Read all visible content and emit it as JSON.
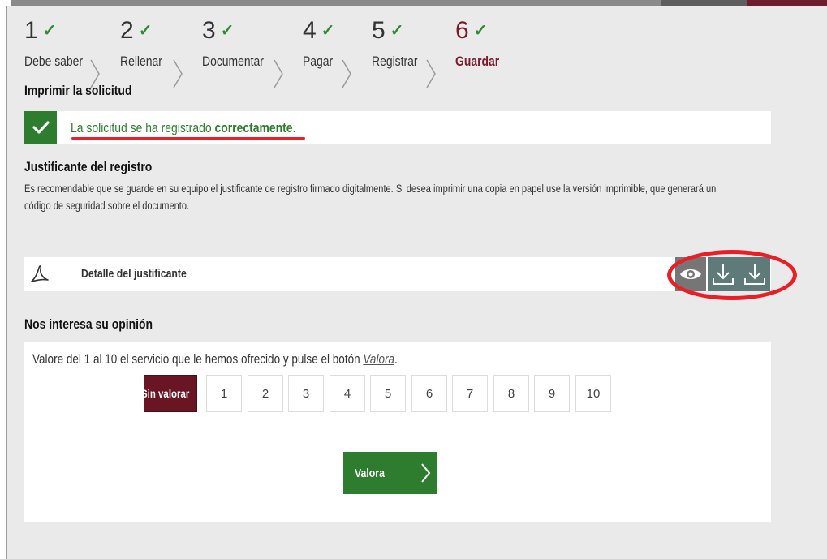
{
  "steps": [
    {
      "num": "1",
      "label": "Debe saber"
    },
    {
      "num": "2",
      "label": "Rellenar"
    },
    {
      "num": "3",
      "label": "Documentar"
    },
    {
      "num": "4",
      "label": "Pagar"
    },
    {
      "num": "5",
      "label": "Registrar"
    },
    {
      "num": "6",
      "label": "Guardar"
    }
  ],
  "current_step": "6",
  "print_section": {
    "title": "Imprimir la solicitud"
  },
  "success": {
    "text_before": "La solicitud se ha registrado ",
    "text_bold": "correctamente",
    "text_after": "."
  },
  "receipt": {
    "title": "Justificante del registro",
    "description": "Es recomendable que se guarde en su equipo el justificante de registro firmado digitalmente. Si desea imprimir una copia en papel use la versión imprimible, que generará un código de seguridad sobre el documento.",
    "detail_label": "Detalle del justificante",
    "icons": {
      "file": "pdf-icon",
      "view": "eye-icon",
      "download": "download-icon"
    }
  },
  "opinion": {
    "title": "Nos interesa su opinión",
    "intro_text": "Valore del 1 al 10 el servicio que le hemos ofrecido y pulse el botón ",
    "intro_link": "Valora",
    "intro_after": ".",
    "unrated_label": "Sin valorar",
    "scale": [
      "1",
      "2",
      "3",
      "4",
      "5",
      "6",
      "7",
      "8",
      "9",
      "10"
    ],
    "submit_label": "Valora"
  },
  "colors": {
    "success_green": "#2e7d2e",
    "current_step": "#7a1a2a",
    "highlight_red": "#ea1e24",
    "download_teal": "#5e7b79"
  }
}
